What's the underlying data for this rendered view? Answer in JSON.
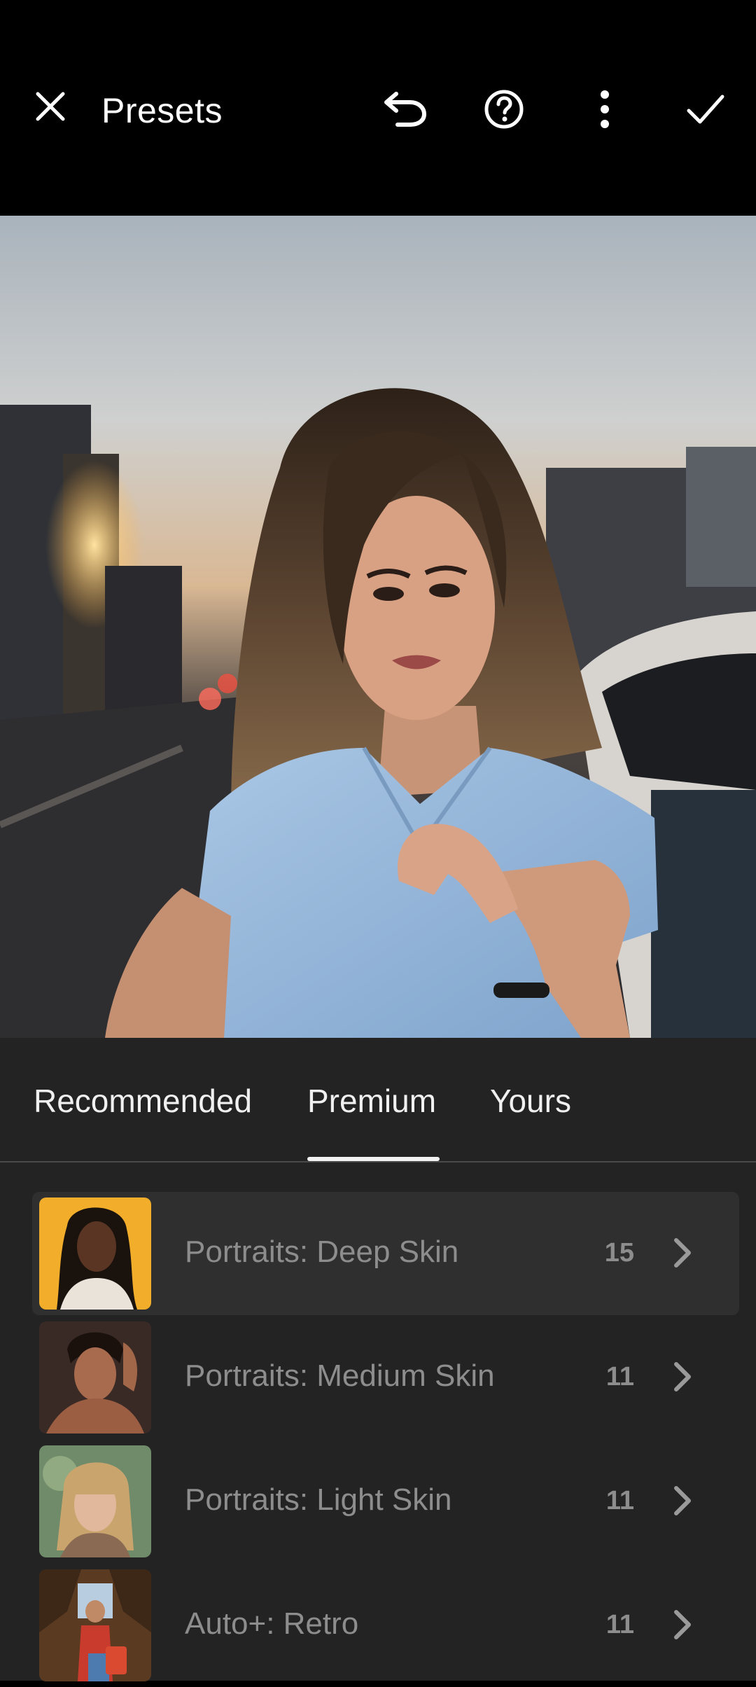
{
  "header": {
    "title": "Presets",
    "close_icon": "close-icon",
    "undo_icon": "undo-icon",
    "help_icon": "help-icon",
    "more_icon": "more-vertical-icon",
    "done_icon": "checkmark-icon"
  },
  "photo": {
    "subject": "portrait photo preview"
  },
  "tabs": [
    {
      "label": "Recommended",
      "active": false
    },
    {
      "label": "Premium",
      "active": true
    },
    {
      "label": "Yours",
      "active": false
    }
  ],
  "presets": [
    {
      "label": "Portraits: Deep Skin",
      "count": "15",
      "selected": true
    },
    {
      "label": "Portraits: Medium Skin",
      "count": "11",
      "selected": false
    },
    {
      "label": "Portraits: Light Skin",
      "count": "11",
      "selected": false
    },
    {
      "label": "Auto+: Retro",
      "count": "11",
      "selected": false
    }
  ],
  "colors": {
    "background": "#000000",
    "panel": "#232323",
    "selected_row": "#2f2f2f",
    "muted_text": "#8d8d8d"
  }
}
